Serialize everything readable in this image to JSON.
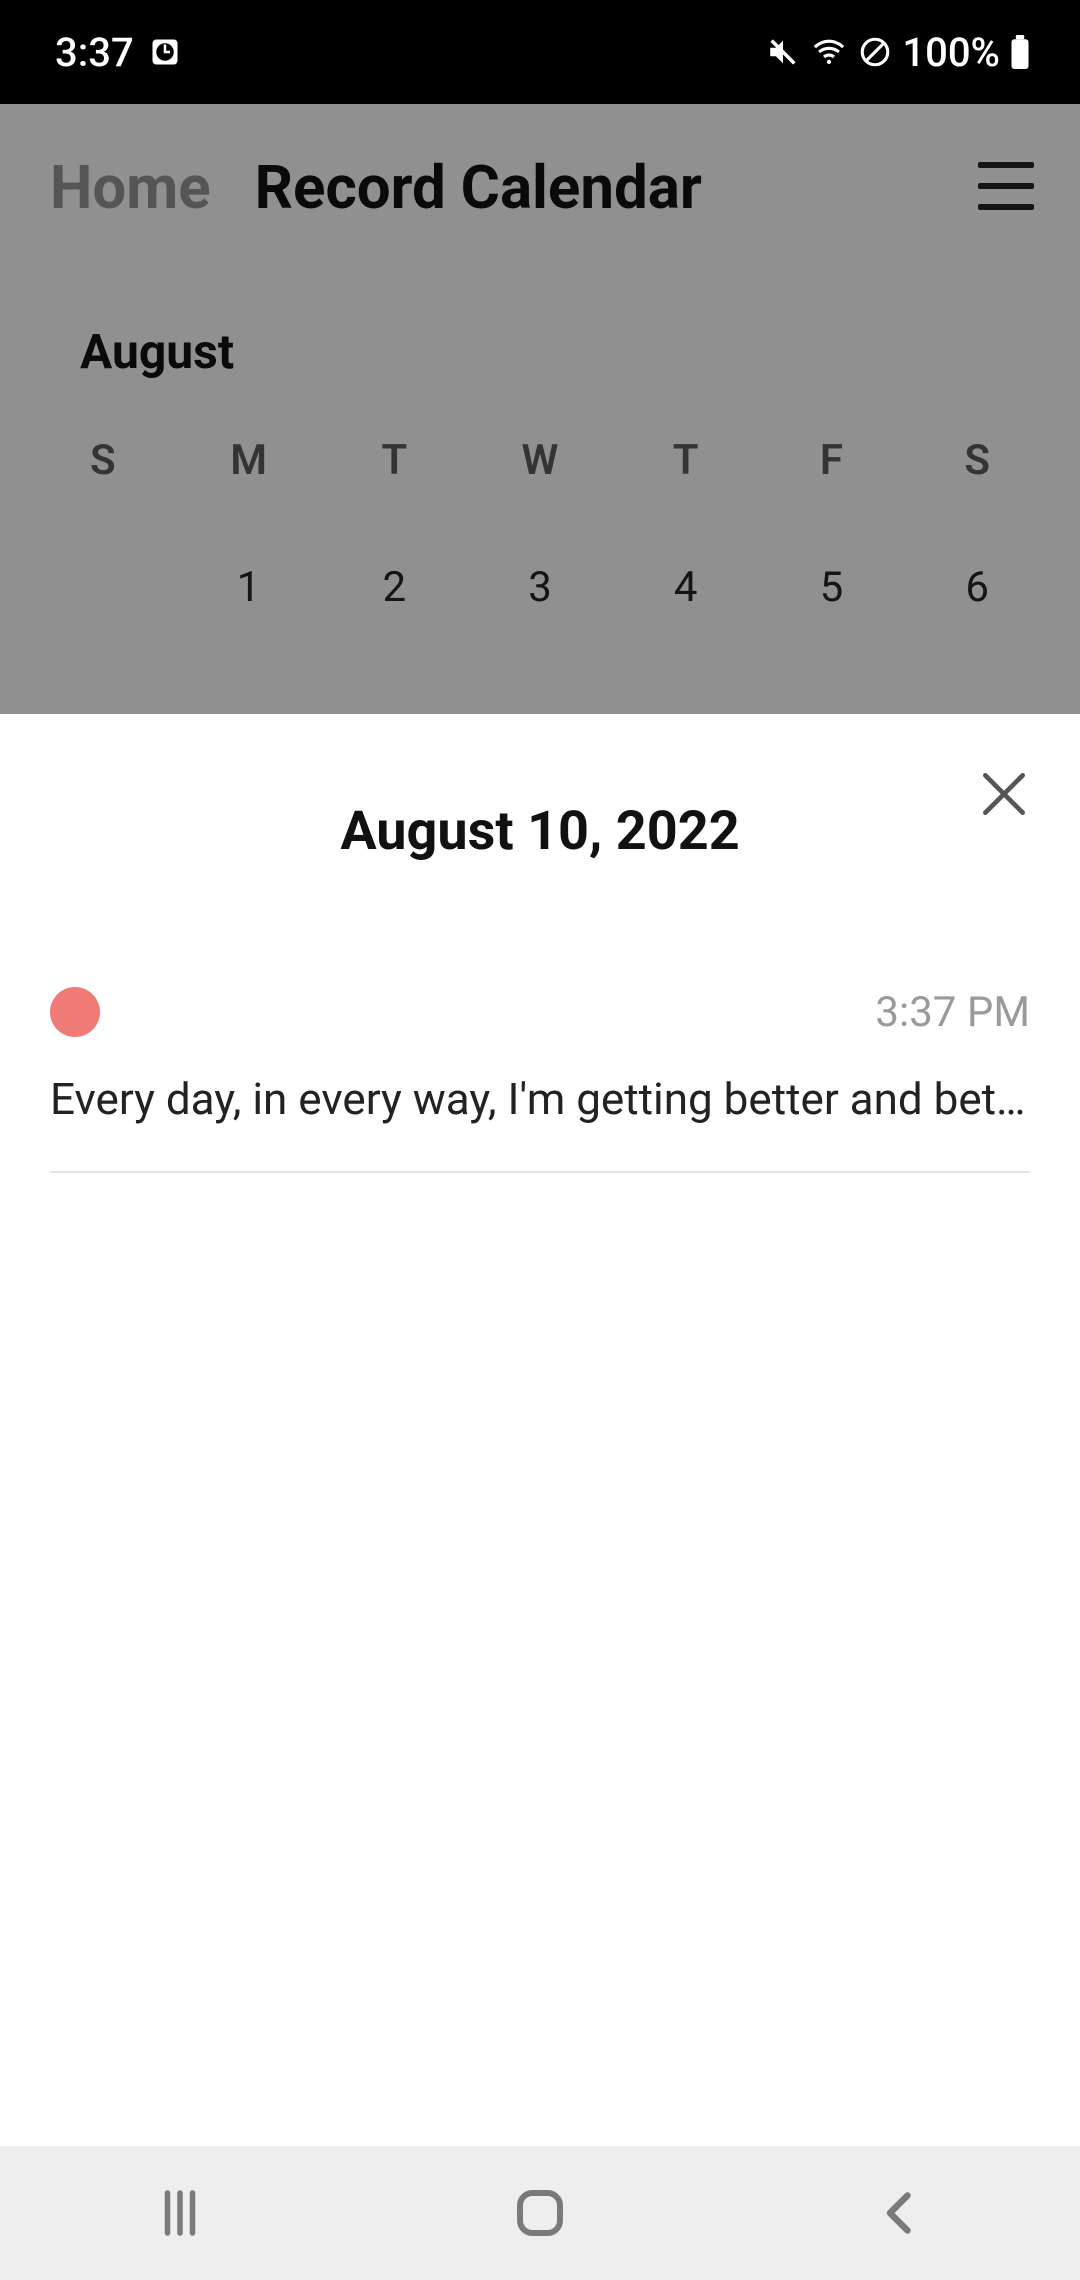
{
  "status": {
    "time": "3:37",
    "battery": "100%"
  },
  "tabs": {
    "home": "Home",
    "record": "Record Calendar"
  },
  "calendar": {
    "month": "August",
    "dow": [
      "S",
      "M",
      "T",
      "W",
      "T",
      "F",
      "S"
    ],
    "row1": [
      "",
      "1",
      "2",
      "3",
      "4",
      "5",
      "6"
    ]
  },
  "sheet": {
    "title": "August 10, 2022"
  },
  "entry": {
    "time": "3:37 PM",
    "text": "Every day, in every way, I'm getting better and better…",
    "dot_color": "#f07a76"
  }
}
